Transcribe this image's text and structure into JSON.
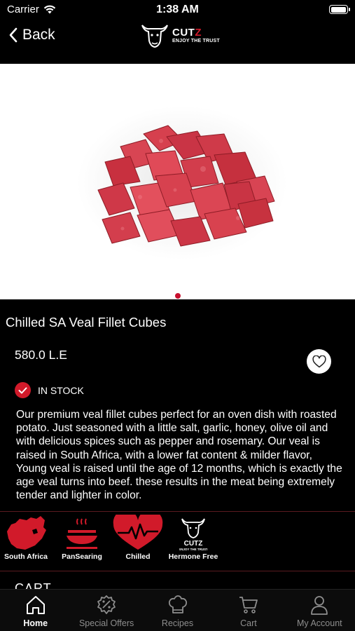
{
  "status_bar": {
    "carrier": "Carrier",
    "time": "1:38 AM",
    "battery_level": 1.0
  },
  "nav": {
    "back_label": "Back",
    "logo_name_prefix": "CUT",
    "logo_name_suffix": "Z",
    "logo_tagline": "ENJOY THE TRUST"
  },
  "product": {
    "title": "Chilled SA Veal Fillet Cubes",
    "price": "580.0 L.E",
    "stock_status": "IN STOCK",
    "description": "Our premium veal fillet cubes perfect for an oven dish with roasted potato. Just seasoned with a little salt, garlic, honey, olive oil and with delicious spices such as pepper and rosemary. Our veal is raised in South Africa, with a lower fat content & milder flavor, Young veal is raised until the age of 12 months, which is exactly the age veal turns into beef. these results in the meat being extremely tender and lighter in color.",
    "image_page_count": 1,
    "image_page_active": 1
  },
  "features": [
    {
      "label": "South Africa",
      "icon": "south-africa-map-icon"
    },
    {
      "label": "PanSearing",
      "icon": "pan-searing-icon"
    },
    {
      "label": "Chilled",
      "icon": "heart-pulse-icon"
    },
    {
      "label": "Hermone Free",
      "icon": "cutz-logo-icon"
    }
  ],
  "cart_heading": "CART",
  "tabs": [
    {
      "label": "Home",
      "icon": "home-icon",
      "active": true
    },
    {
      "label": "Special Offers",
      "icon": "discount-badge-icon",
      "active": false
    },
    {
      "label": "Recipes",
      "icon": "chef-hat-icon",
      "active": false
    },
    {
      "label": "Cart",
      "icon": "cart-icon",
      "active": false
    },
    {
      "label": "My Account",
      "icon": "user-icon",
      "active": false
    }
  ],
  "colors": {
    "accent": "#d11a2a",
    "background": "#000000",
    "tab_inactive": "#8e8e8e"
  }
}
